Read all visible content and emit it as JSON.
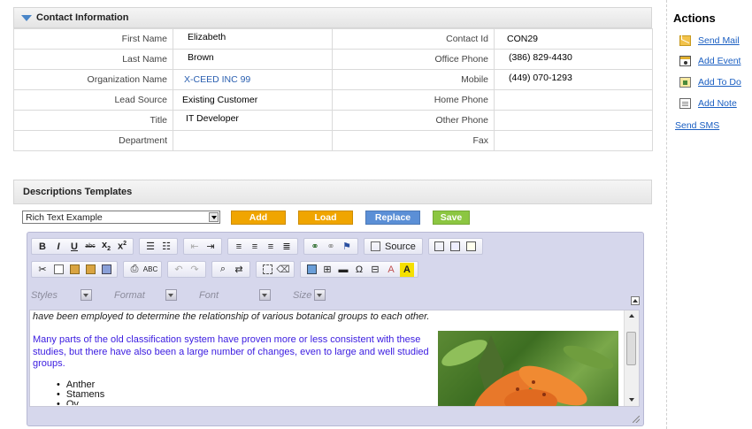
{
  "contact_section": {
    "title": "Contact Information",
    "rows": [
      {
        "left_label": "First Name",
        "left_value": "Elizabeth",
        "right_label": "Contact Id",
        "right_value": "CON29"
      },
      {
        "left_label": "Last Name",
        "left_value": "Brown",
        "right_label": "Office Phone",
        "right_value": "(386) 829-4430"
      },
      {
        "left_label": "Organization Name",
        "left_value": "X-CEED INC 99",
        "right_label": "Mobile",
        "right_value": "(449) 070-1293"
      },
      {
        "left_label": "Lead Source",
        "left_value": "Existing Customer",
        "right_label": "Home Phone",
        "right_value": ""
      },
      {
        "left_label": "Title",
        "left_value": "IT Developer",
        "right_label": "Other Phone",
        "right_value": ""
      },
      {
        "left_label": "Department",
        "left_value": "",
        "right_label": "Fax",
        "right_value": ""
      }
    ]
  },
  "actions": {
    "title": "Actions",
    "items": [
      {
        "label": "Send Mail",
        "icon": "mail-icon"
      },
      {
        "label": "Add Event",
        "icon": "calendar-icon"
      },
      {
        "label": "Add To Do",
        "icon": "todo-icon"
      },
      {
        "label": "Add Note",
        "icon": "note-icon"
      },
      {
        "label": "Send SMS",
        "icon": ""
      }
    ]
  },
  "templates": {
    "title": "Descriptions Templates",
    "selected": "Rich Text Example",
    "buttons": {
      "add": "Add",
      "load": "Load",
      "replace": "Replace",
      "save": "Save"
    },
    "colors": {
      "add": "#f0a500",
      "load": "#f0a500",
      "replace": "#5b8fd6",
      "save": "#8cc641"
    }
  },
  "editor": {
    "source_label": "Source",
    "combos": {
      "styles": "Styles",
      "format": "Format",
      "font": "Font",
      "size": "Size"
    },
    "content": {
      "line1": "have been employed to determine the relationship of various botanical groups to each other.",
      "para": "Many parts of the old classification system have proven more or less consistent with these studies, but there have also been a large number of changes, even to large and well studied groups.",
      "bullets": [
        "Anther",
        "Stamens",
        "Ov..."
      ]
    }
  }
}
